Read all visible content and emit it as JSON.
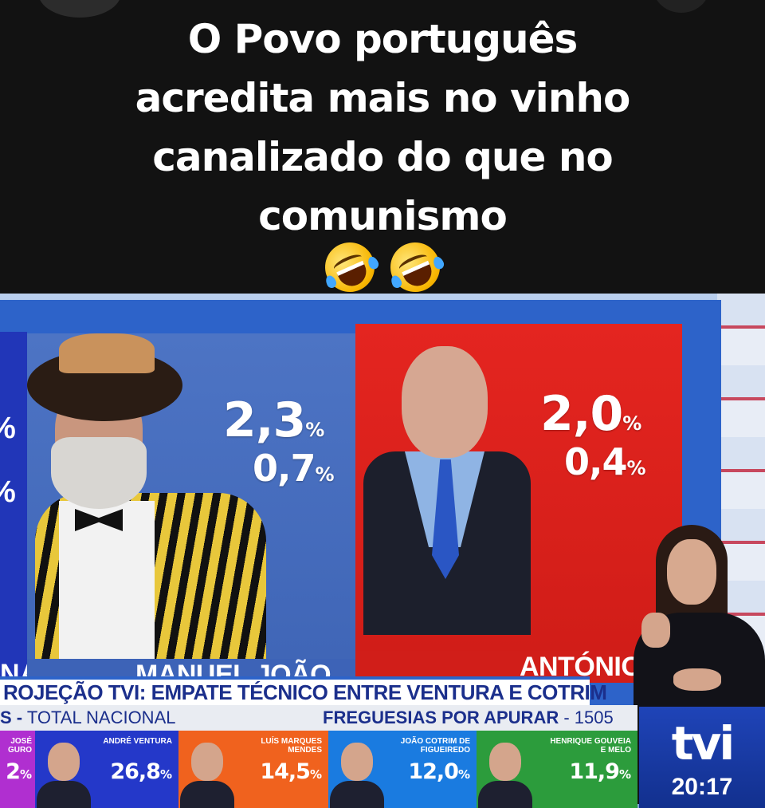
{
  "caption": {
    "lines": [
      "O Povo português",
      "acredita mais no vinho",
      "canalizado do que no",
      "comunismo"
    ],
    "emojis": [
      "rolling-on-floor-laughing",
      "rolling-on-floor-laughing"
    ]
  },
  "broadcast": {
    "left_edge_marks": [
      "%",
      "%"
    ],
    "left_edge_tag": "NA",
    "candidate_left": {
      "percent_main": "2,3",
      "percent_sub": "0,7",
      "unit": "%",
      "name": "MANUEL JOÃO",
      "color": "#3f65b6"
    },
    "candidate_right": {
      "percent_main": "2,0",
      "percent_sub": "0,4",
      "unit": "%",
      "name": "ANTÓNIO",
      "color": "#d11e19"
    },
    "ticker": "ROJEÇÃO TVI: EMPATE TÉCNICO ENTRE VENTURA E COTRIM",
    "subbar_left_prefix": "S -",
    "subbar_left": "TOTAL NACIONAL",
    "subbar_right_label": "FREGUESIAS POR APURAR",
    "subbar_right_value": "1505",
    "cards": [
      {
        "name": "JOSÉ GURO",
        "pct": "2",
        "color": "#b02fd0"
      },
      {
        "name": "ANDRÉ VENTURA",
        "pct": "26,8",
        "color": "#2438c9"
      },
      {
        "name": "LUÍS MARQUES MENDES",
        "pct": "14,5",
        "color": "#f0621e"
      },
      {
        "name": "JOÃO COTRIM DE FIGUEIREDO",
        "pct": "12,0",
        "color": "#1a7be0"
      },
      {
        "name": "HENRIQUE GOUVEIA E MELO",
        "pct": "11,9",
        "color": "#2c9c3c"
      }
    ],
    "channel": {
      "logo": "tvi",
      "time": "20:17"
    }
  }
}
